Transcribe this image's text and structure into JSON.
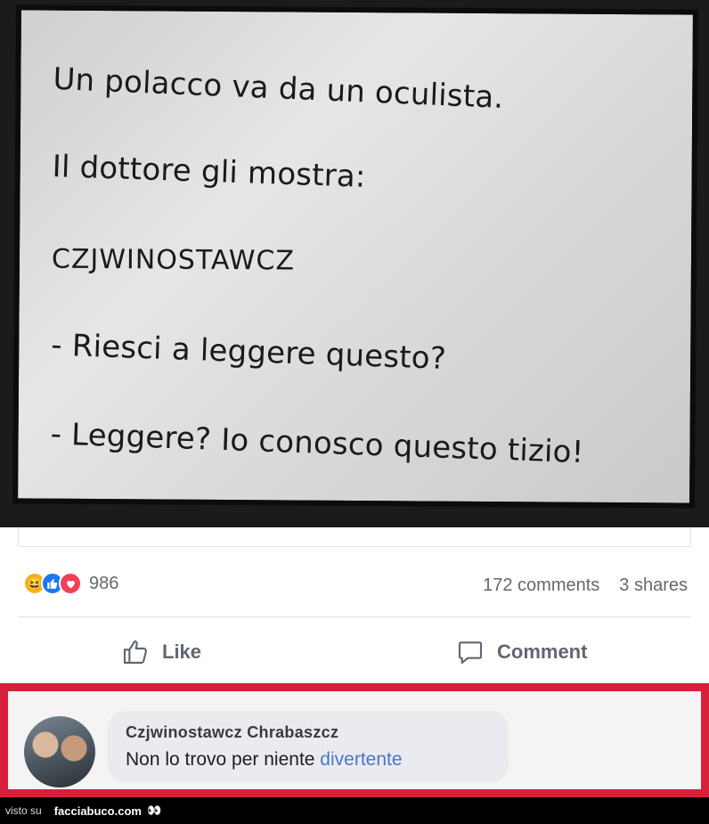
{
  "paper": {
    "line1": "Un polacco va da un oculista.",
    "line2": "Il dottore gli mostra:",
    "line3": "CZJWINOSTAWCZ",
    "line4": "- Riesci a leggere questo?",
    "line5": "- Leggere? Io conosco questo tizio!"
  },
  "post": {
    "reaction_count": "986",
    "comments": "172 comments",
    "shares": "3 shares",
    "like_label": "Like",
    "comment_label": "Comment"
  },
  "comment": {
    "author": "Czjwinostawcz Chrabaszcz",
    "text_plain": "Non lo trovo per niente ",
    "text_link": "divertente"
  },
  "footer": {
    "visto_su": "visto su",
    "brand": "facciabuco.com",
    "eyes": "👀"
  },
  "colors": {
    "highlight_border": "#d6203a",
    "like_blue": "#1877f2",
    "love_red": "#f33e58",
    "haha_yellow": "#f7b125",
    "link_blue": "#4a76c9"
  },
  "icons": [
    "haha-reaction-icon",
    "like-reaction-icon",
    "love-reaction-icon",
    "thumbs-up-icon",
    "speech-bubble-icon"
  ]
}
